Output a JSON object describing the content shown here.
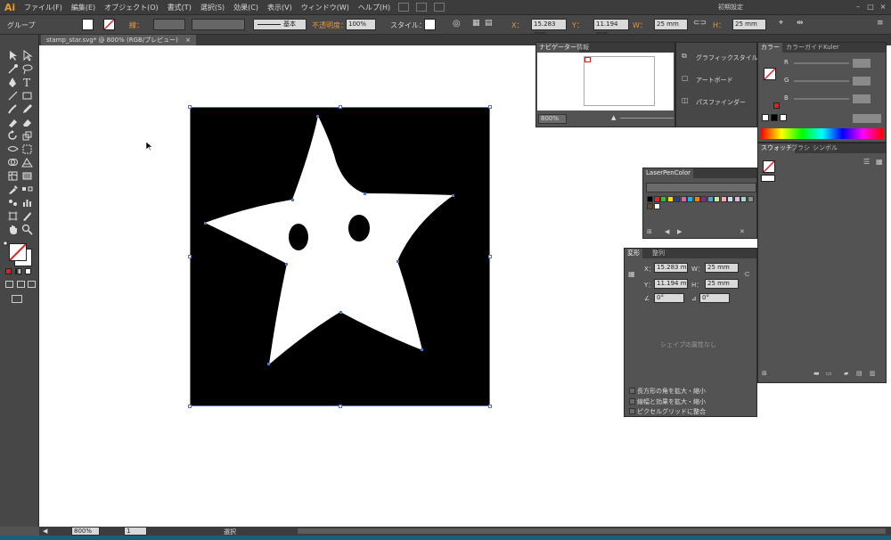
{
  "app": {
    "logo": "Ai",
    "workspace": "初期設定"
  },
  "menu": [
    "ファイル(F)",
    "編集(E)",
    "オブジェクト(O)",
    "書式(T)",
    "選択(S)",
    "効果(C)",
    "表示(V)",
    "ウィンドウ(W)",
    "ヘルプ(H)"
  ],
  "window_buttons": [
    "–",
    "□",
    "×"
  ],
  "control": {
    "selection_label": "グループ",
    "stroke_label": "線：",
    "brush_label": "基本",
    "opacity_label": "不透明度：",
    "opacity_value": "100%",
    "style_label": "スタイル：",
    "x_label": "X：",
    "x_value": "15.283 mm",
    "y_label": "Y：",
    "y_value": "11.194 mm",
    "w_label": "W：",
    "w_value": "25 mm",
    "h_label": "H：",
    "h_value": "25 mm"
  },
  "document": {
    "tab_title": "stamp_star.svg* @ 800% (RGB/プレビュー)",
    "tab_close": "×"
  },
  "status": {
    "zoom": "800%",
    "page": "1",
    "mode": "選択"
  },
  "navigator": {
    "tabs": [
      "ナビゲーター",
      "情報"
    ],
    "zoom": "800%"
  },
  "side_panel": {
    "items": [
      "グラフィックスタイル",
      "アートボード",
      "パスファインダー"
    ]
  },
  "color_panel": {
    "tabs": [
      "カラー",
      "カラーガイド",
      "Kuler"
    ],
    "channels": [
      "R",
      "G",
      "B"
    ]
  },
  "swatches_panel": {
    "tabs": [
      "スウォッチ",
      "ブラシ",
      "シンボル"
    ]
  },
  "laserpen": {
    "title": "LaserPenColor",
    "colors": [
      "#000000",
      "#e8212a",
      "#3cb64a",
      "#ffd900",
      "#2a3aa8",
      "#ea5ea1",
      "#19b7e8",
      "#ef7f1a",
      "#7b2e86",
      "#44a7e0",
      "#cbe6a6",
      "#f6aab3",
      "#bfe2f2",
      "#dcb8dc",
      "#a6d9c8",
      "#8e8e8e",
      "#6b4724",
      "#ffffff"
    ]
  },
  "transform": {
    "tabs": [
      "変形",
      "整列"
    ],
    "x_label": "X：",
    "x_value": "15.283 mm",
    "w_label": "W：",
    "w_value": "25 mm",
    "y_label": "Y：",
    "y_value": "11.194 mm",
    "h_label": "H：",
    "h_value": "25 mm",
    "angle_value": "0°",
    "shear_value": "0°",
    "empty_msg": "シェイプの属性なし",
    "options": [
      "長方形の角を拡大・縮小",
      "線幅と効果を拡大・縮小",
      "ピクセルグリッドに整合"
    ]
  },
  "colors": {
    "accent": "#e8963a",
    "selection": "#4a74c8",
    "ui_bg": "#535353"
  }
}
